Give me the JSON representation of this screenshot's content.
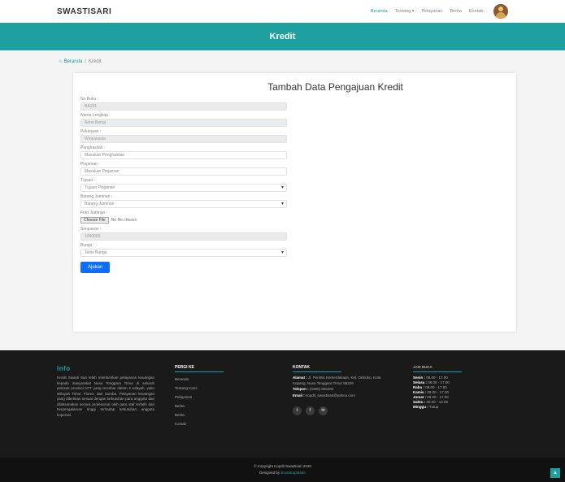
{
  "navbar": {
    "brand": "SWASTISARI",
    "items": [
      "Beranda",
      "Tentang ▾",
      "Pelayanan",
      "Berita",
      "Kontak"
    ]
  },
  "banner": {
    "title": "Kredit"
  },
  "breadcrumb": {
    "home": "Beranda",
    "sep": "/",
    "current": "Kredit"
  },
  "form": {
    "title": "Tambah Data Pengajuan Kredit",
    "fields": [
      {
        "label": "No Buku :",
        "value": "BA191"
      },
      {
        "label": "Nama Lengkap :",
        "value": "Arinn Bengi"
      },
      {
        "label": "Pekerjaan :",
        "value": "Wiraswasta"
      },
      {
        "label": "Penghasilan :",
        "placeholder": "Masukan Penghasilan"
      },
      {
        "label": "Pinjaman :",
        "placeholder": "Masukan Pinjaman"
      },
      {
        "label": "Tujuan :",
        "value": "Tujuan Pinjaman"
      },
      {
        "label": "Barang Jaminan :",
        "value": "Barang Jaminan"
      },
      {
        "label": "Foto Jaminan :",
        "button": "Choose File",
        "file_status": "No file chosen"
      },
      {
        "label": "Simpanan :",
        "value": "1000000"
      },
      {
        "label": "Bunga :",
        "value": "Jenis Bunga"
      }
    ],
    "submit": "Ajukan"
  },
  "footer": {
    "info": {
      "title": "Info",
      "text": "Kredit Swasti Sari telah memberikan pelayanan keuangan kepada masyarakat Nusa Tenggara Timur di seluruh pelosok provinsi NTT yang tersebar dalam 2 wilayah, yaitu Wilayah Timor, Flores, dan Sumba. Pelayanan keuangan yang diberikan sesuai dengan kebutuhan para anggota dan dilaksanakan secara profesional oleh para staf terlatih dan berpengalaman tinggi terhadap kebutuhan anggota koperasi."
    },
    "menu": {
      "title": "PERGI KE",
      "links": [
        "Beranda",
        "Tentang Kami",
        "Pelayanan",
        "Berita",
        "Berita",
        "Kontak"
      ]
    },
    "contact": {
      "title": "KONTAK",
      "address_label": "Alamat :",
      "address": "Jl. Perintis Kemerdekaan, Kel. Oebobo, Kota Kupang, Nusa Tenggara Timur 85228",
      "phone_label": "Telepon :",
      "phone": "(0380) 826282",
      "email_label": "Email :",
      "email": "kopdit_swastisari@yahoo.com",
      "social": [
        "twitter-icon",
        "facebook-icon",
        "mail-icon"
      ]
    },
    "hours": {
      "title": "JAM BUKA",
      "rows": [
        {
          "day": "Senin :",
          "time": "08.00 - 17.00"
        },
        {
          "day": "Selasa :",
          "time": "08.00 - 17.00"
        },
        {
          "day": "Rabu :",
          "time": "08.00 - 17.00"
        },
        {
          "day": "Kamis :",
          "time": "08.00 - 17.00"
        },
        {
          "day": "Jumat :",
          "time": "08.00 - 17.00"
        },
        {
          "day": "Sabtu :",
          "time": "08.00 - 13.00"
        },
        {
          "day": "Minggu :",
          "time": "Tutup"
        }
      ]
    }
  },
  "copyright": {
    "line1": "© Copyright Kopdit Swastisari 2020",
    "line2_prefix": "Designed by",
    "line2_link": "BootstrapMade"
  },
  "to_top": "▲"
}
